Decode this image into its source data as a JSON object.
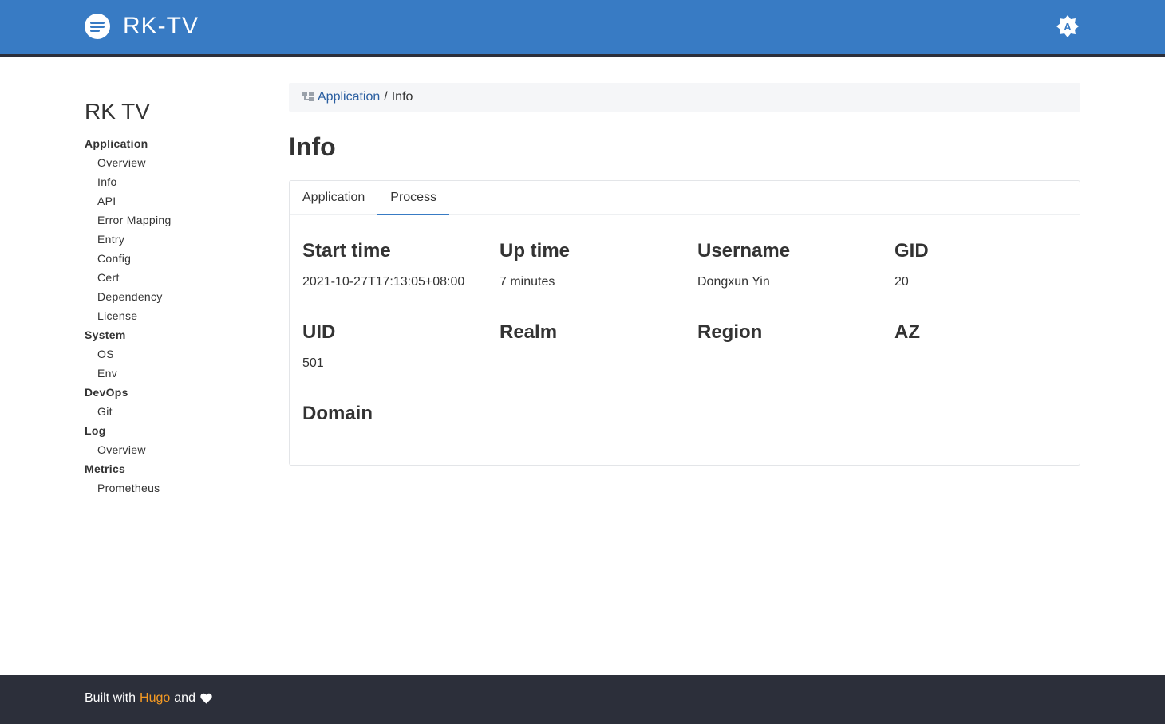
{
  "header": {
    "brand_name": "RK-TV",
    "theme_toggle_letter": "A"
  },
  "sidebar": {
    "title": "RK TV",
    "groups": [
      {
        "label": "Application",
        "items": [
          "Overview",
          "Info",
          "API",
          "Error Mapping",
          "Entry",
          "Config",
          "Cert",
          "Dependency",
          "License"
        ]
      },
      {
        "label": "System",
        "items": [
          "OS",
          "Env"
        ]
      },
      {
        "label": "DevOps",
        "items": [
          "Git"
        ]
      },
      {
        "label": "Log",
        "items": [
          "Overview"
        ]
      },
      {
        "label": "Metrics",
        "items": [
          "Prometheus"
        ]
      }
    ]
  },
  "breadcrumb": {
    "parent": "Application",
    "separator": "/",
    "current": "Info"
  },
  "page": {
    "title": "Info"
  },
  "tabs": [
    {
      "label": "Application",
      "active": false
    },
    {
      "label": "Process",
      "active": true
    }
  ],
  "fields": [
    {
      "label": "Start time",
      "value": "2021-10-27T17:13:05+08:00"
    },
    {
      "label": "Up time",
      "value": "7 minutes"
    },
    {
      "label": "Username",
      "value": "Dongxun Yin"
    },
    {
      "label": "GID",
      "value": "20"
    },
    {
      "label": "UID",
      "value": "501"
    },
    {
      "label": "Realm",
      "value": ""
    },
    {
      "label": "Region",
      "value": ""
    },
    {
      "label": "AZ",
      "value": ""
    },
    {
      "label": "Domain",
      "value": ""
    }
  ],
  "footer": {
    "prefix": "Built with",
    "link": "Hugo",
    "suffix": "and"
  },
  "colors": {
    "header_bg": "#387bc4",
    "dark_bar": "#2c2f3a",
    "link": "#2a5ea0",
    "footer_link": "#f59a23"
  }
}
